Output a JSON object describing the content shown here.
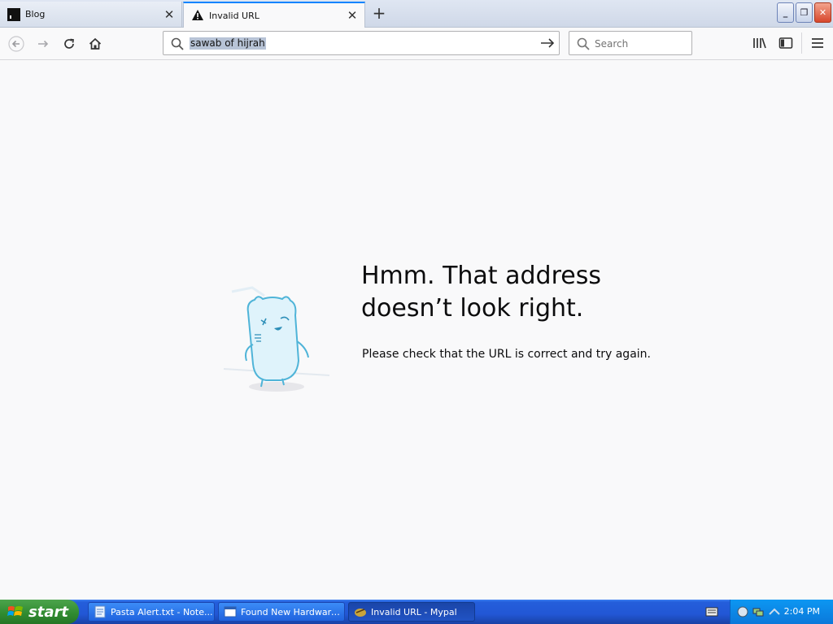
{
  "browser": {
    "tabs": [
      {
        "title": "Blog",
        "active": false
      },
      {
        "title": "Invalid URL",
        "active": true
      }
    ],
    "url_text": "sawab of hijrah",
    "search_placeholder": "Search"
  },
  "error_page": {
    "headline_line1": "Hmm. That address",
    "headline_line2": "doesn’t look right.",
    "description": "Please check that the URL is correct and try again."
  },
  "taskbar": {
    "start_label": "start",
    "tasks": [
      {
        "label": "Pasta Alert.txt - Note..."
      },
      {
        "label": "Found New Hardware..."
      },
      {
        "label": "Invalid URL - Mypal"
      }
    ],
    "clock": "2:04 PM"
  },
  "colors": {
    "accent": "#0a84ff",
    "taskbar_blue": "#245edb",
    "start_green": "#3a9a3a"
  }
}
